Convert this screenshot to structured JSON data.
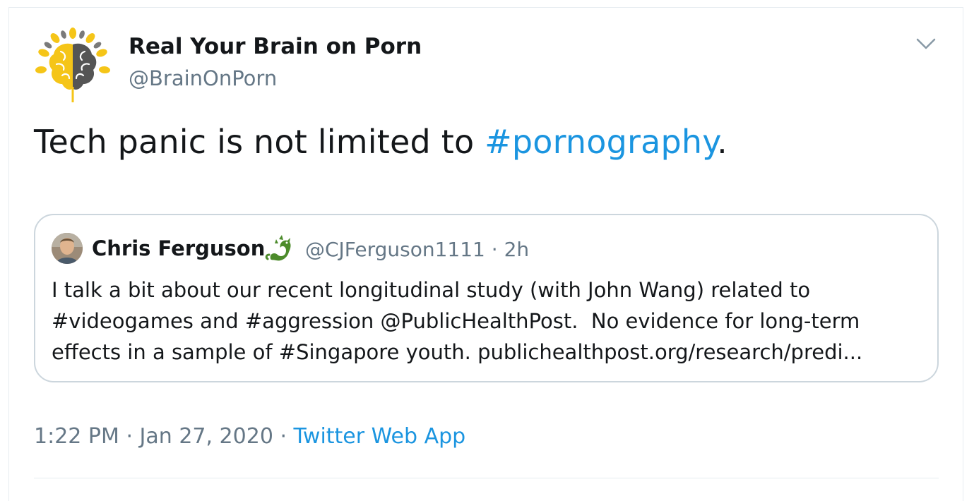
{
  "author": {
    "display_name": "Real Your Brain on Porn",
    "handle": "@BrainOnPorn",
    "avatar_icon": "brain-sunflower-logo"
  },
  "tweet": {
    "text_prefix": "Tech panic is not limited to ",
    "hashtag": "#pornography",
    "text_suffix": "."
  },
  "quoted_tweet": {
    "display_name": "Chris Ferguson",
    "badge_icon": "dragon-icon",
    "handle": "@CJFerguson1111",
    "separator": "·",
    "time_ago": "2h",
    "lines": [
      "I talk a bit about our recent longitudinal study (with John Wang) related to",
      "#videogames and #aggression @PublicHealthPost.  No evidence for long-term",
      "effects in a sample of #Singapore youth. publichealthpost.org/research/predi..."
    ]
  },
  "footer": {
    "time": "1:22 PM",
    "sep1": "·",
    "date": "Jan 27, 2020",
    "sep2": "·",
    "source": "Twitter Web App"
  },
  "colors": {
    "link": "#1b95e0",
    "secondary_text": "#657786",
    "border": "#ccd6dd",
    "logo_yellow": "#f5c518",
    "logo_gray": "#555555",
    "dragon_green": "#4c8b2b"
  }
}
